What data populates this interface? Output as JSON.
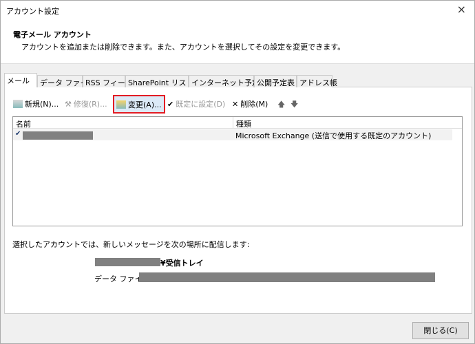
{
  "window": {
    "title": "アカウント設定",
    "close": "×"
  },
  "header": {
    "title": "電子メール アカウント",
    "subtitle": "アカウントを追加または削除できます。また、アカウントを選択してその設定を変更できます。"
  },
  "tabs": [
    "メール",
    "データ ファイル",
    "RSS フィード",
    "SharePoint リスト",
    "インターネット予定表",
    "公開予定表",
    "アドレス帳"
  ],
  "toolbar": {
    "new": "新規(N)...",
    "repair": "修復(R)...",
    "change": "変更(A)...",
    "set_default": "既定に設定(D)",
    "remove": "削除(M)",
    "up": "🡅",
    "down": "🡇"
  },
  "list": {
    "columns": [
      "名前",
      "種類"
    ],
    "rows": [
      {
        "name": "",
        "type": "Microsoft Exchange (送信で使用する既定のアカウント)"
      }
    ]
  },
  "delivery": {
    "label": "選択したアカウントでは、新しいメッセージを次の場所に配信します:",
    "folder_suffix": "¥受信トレイ",
    "data_file_label": "データ ファイル:"
  },
  "footer": {
    "close": "閉じる(C)"
  }
}
